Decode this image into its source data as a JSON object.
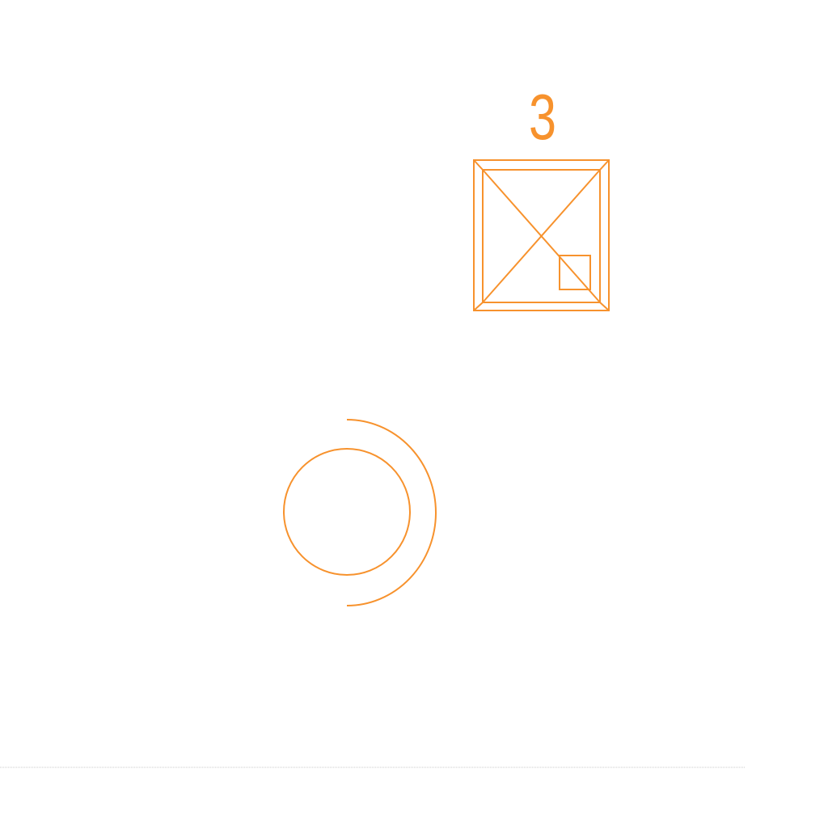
{
  "colors": {
    "stroke": "#f7922d",
    "divider": "#c8c8c8"
  },
  "symbol_box": {
    "number": "3",
    "icon": "square-with-diagonals-icon"
  },
  "symbol_circle": {
    "icon": "circle-with-arc-icon"
  }
}
